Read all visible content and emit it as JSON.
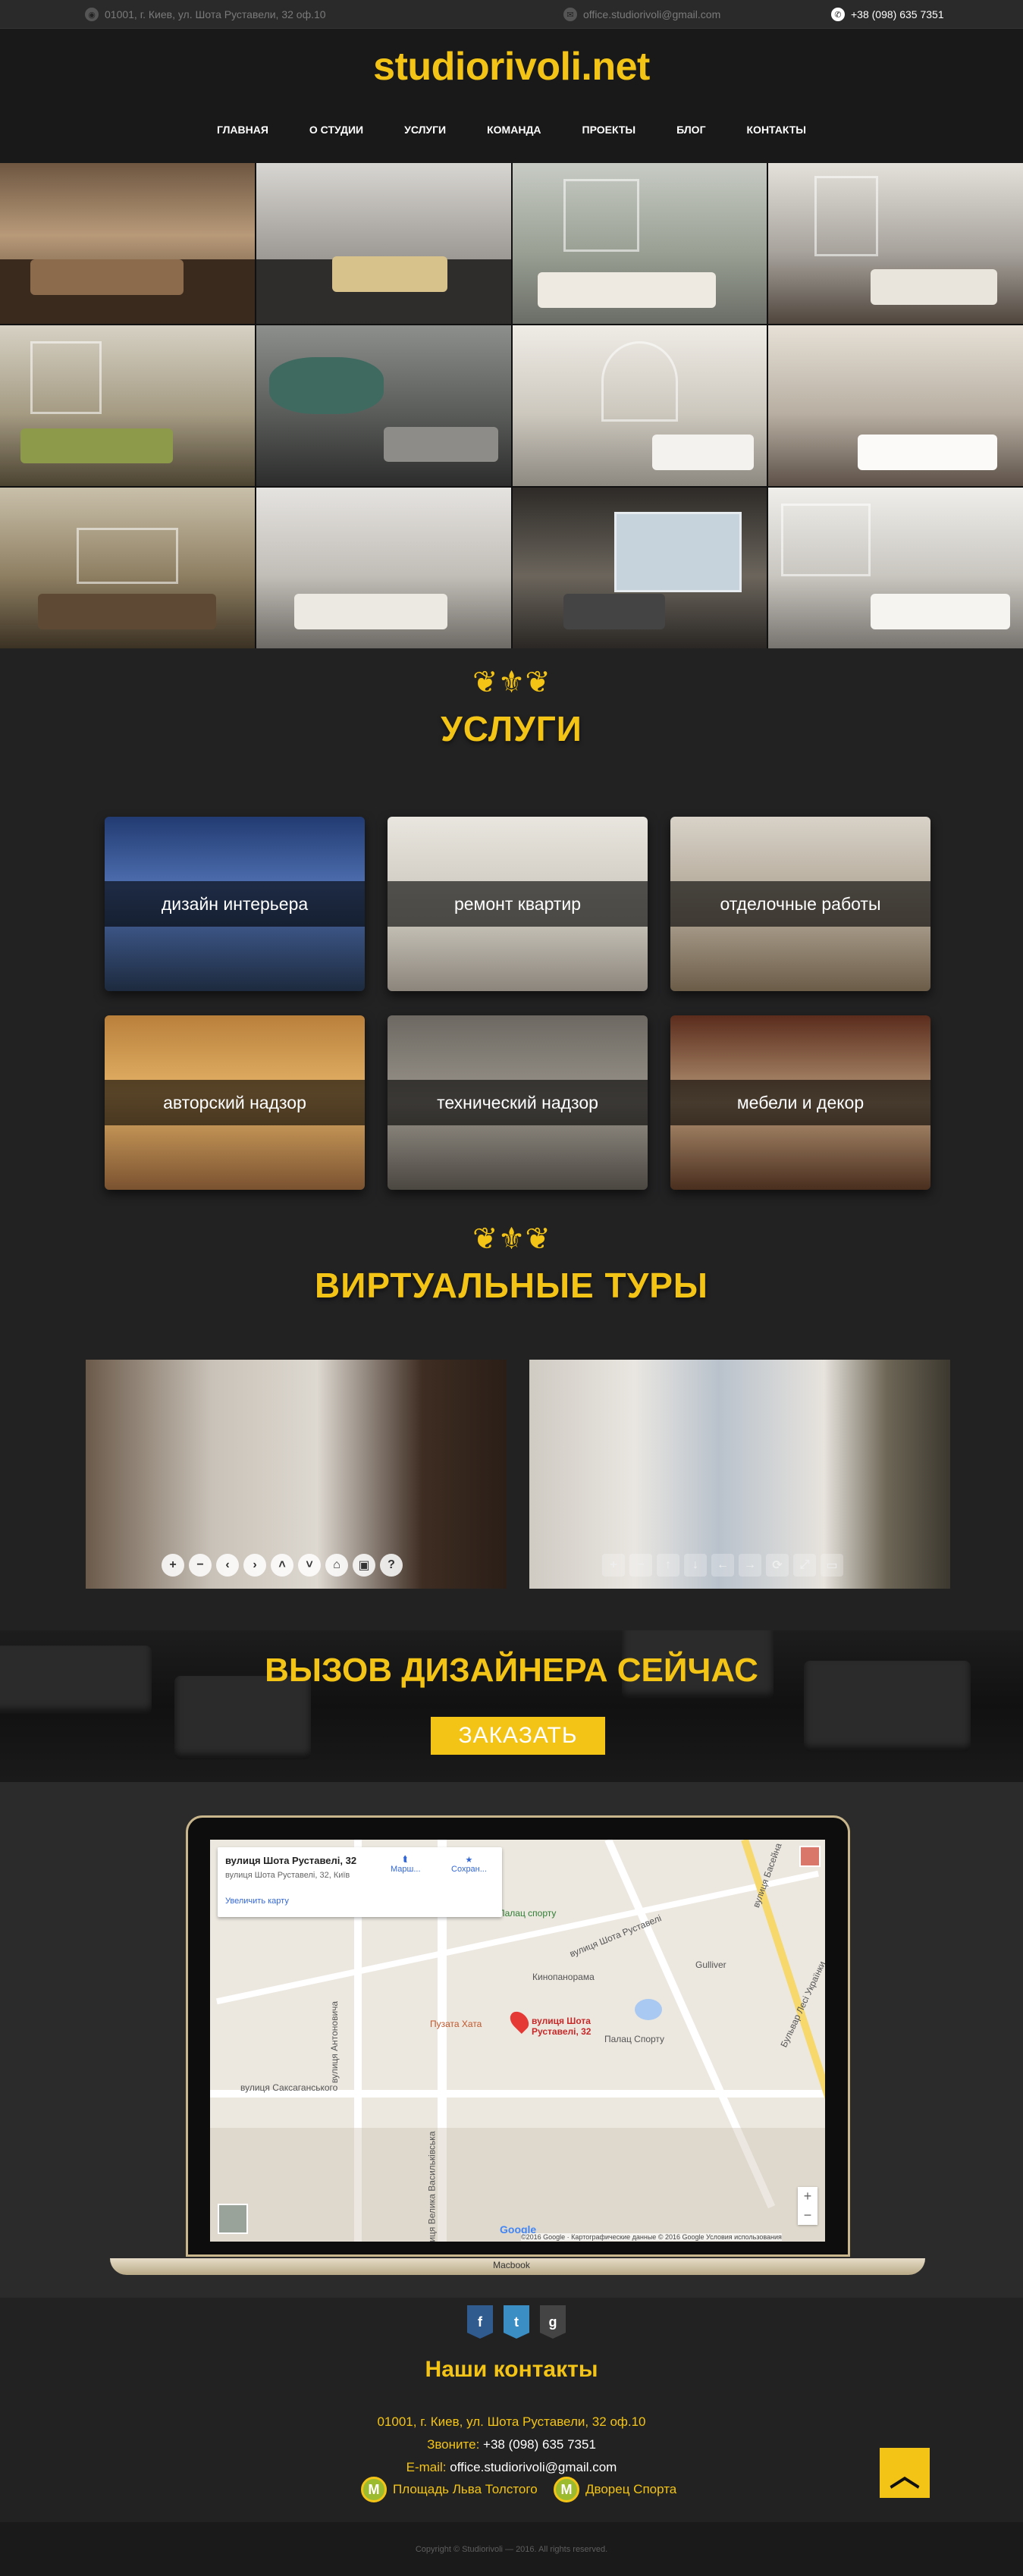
{
  "topbar": {
    "address": "01001, г. Киев, ул. Шота Руставели, 32 оф.10",
    "email": "office.studiorivoli@gmail.com",
    "phone": "+38 (098) 635 7351"
  },
  "header": {
    "logo": "studiorivoli.net",
    "nav": [
      "ГЛАВНАЯ",
      "О СТУДИИ",
      "УСЛУГИ",
      "КОМАНДА",
      "ПРОЕКТЫ",
      "БЛОГ",
      "КОНТАКТЫ"
    ]
  },
  "services": {
    "title": "УСЛУГИ",
    "items": [
      "дизайн интерьера",
      "ремонт квартир",
      "отделочные работы",
      "авторский надзор",
      "технический надзор",
      "мебели и декор"
    ]
  },
  "tours": {
    "title": "ВИРТУАЛЬНЫЕ ТУРЫ"
  },
  "call": {
    "title": "ВЫЗОВ ДИЗАЙНЕРА СЕЙЧАС",
    "button": "ЗАКАЗАТЬ"
  },
  "map": {
    "place_title": "вулиця Шота Руставелі, 32",
    "place_address": "вулиця Шота Руставелі, 32, Київ",
    "enlarge": "Увеличить карту",
    "route": "Марш...",
    "save": "Сохран...",
    "pin_label": "вулиця Шота Руставелі, 32",
    "labels": [
      "Палац спорту",
      "Кинопанорама",
      "Gulliver",
      "Палац Спорту",
      "Пузата Хата",
      "вулиця Саксаганського",
      "вулиця Басейна",
      "Бульвар Лесі Українки",
      "вулиця Велика Васильківська",
      "вулиця Антоновича",
      "вулиця Шота Руставелі"
    ],
    "footer": "©2016 Google · Картографические данные © 2016 Google   Условия использования",
    "google": "Google",
    "macbook": "Macbook"
  },
  "footer": {
    "title": "Наши контакты",
    "address": "01001, г. Киев, ул. Шота Руставели, 32 оф.10",
    "phone_label": "Звоните:",
    "phone": "+38 (098) 635 7351",
    "email_label": "E-mail:",
    "email": "office.studiorivoli@gmail.com",
    "metro": [
      "Площадь Льва Толстого",
      "Дворец Спорта"
    ],
    "copyright": "Copyright © Studiorivoli — 2016. All rights reserved."
  },
  "colors": {
    "accent": "#f3c316",
    "background": "#222223"
  }
}
